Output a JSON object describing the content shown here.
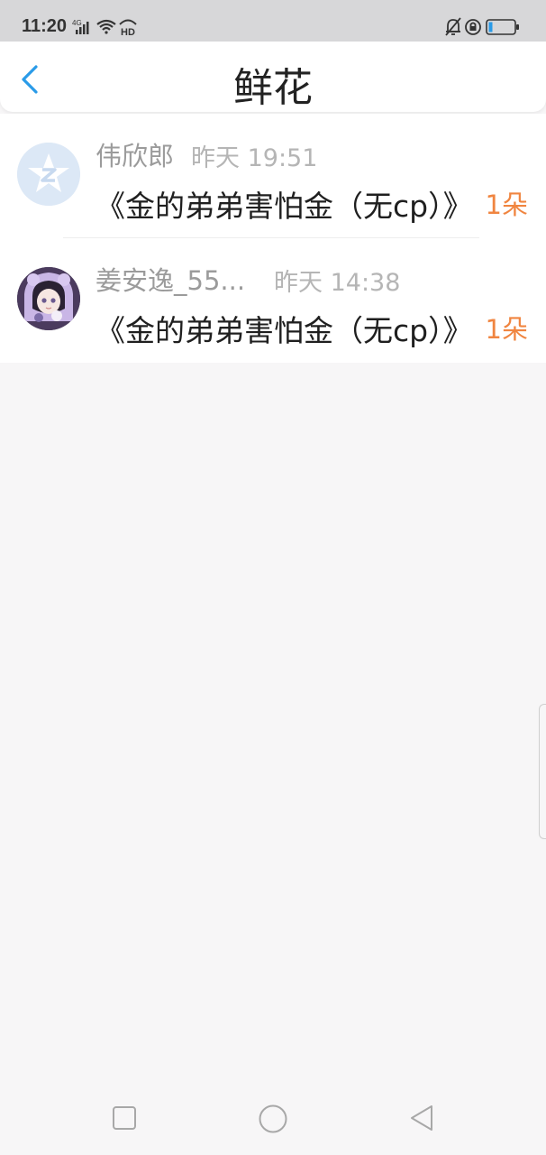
{
  "status_bar": {
    "time": "11:20",
    "left_icons": [
      "signal-4g-icon",
      "wifi-icon",
      "hd-icon"
    ],
    "right_icons": [
      "bell-muted-icon",
      "lock-rotation-icon",
      "battery-icon"
    ]
  },
  "header": {
    "title": "鲜花",
    "back_icon": "chevron-left-icon"
  },
  "colors": {
    "accent_blue": "#2a9be8",
    "count_orange": "#f08540",
    "name_gray": "#9b9b9b"
  },
  "rows": [
    {
      "name": "伟欣郎",
      "time": "昨天 19:51",
      "message": "《金的弟弟害怕金（无cp）》",
      "count": "1朵",
      "avatar": "qzone-star-avatar"
    },
    {
      "name": "姜安逸_55...",
      "time": "昨天 14:38",
      "message": "《金的弟弟害怕金（无cp）》",
      "count": "1朵",
      "avatar": "anime-girl-avatar"
    }
  ],
  "nav_bar": {
    "icons": [
      "recent-apps-icon",
      "home-icon",
      "back-triangle-icon"
    ]
  }
}
